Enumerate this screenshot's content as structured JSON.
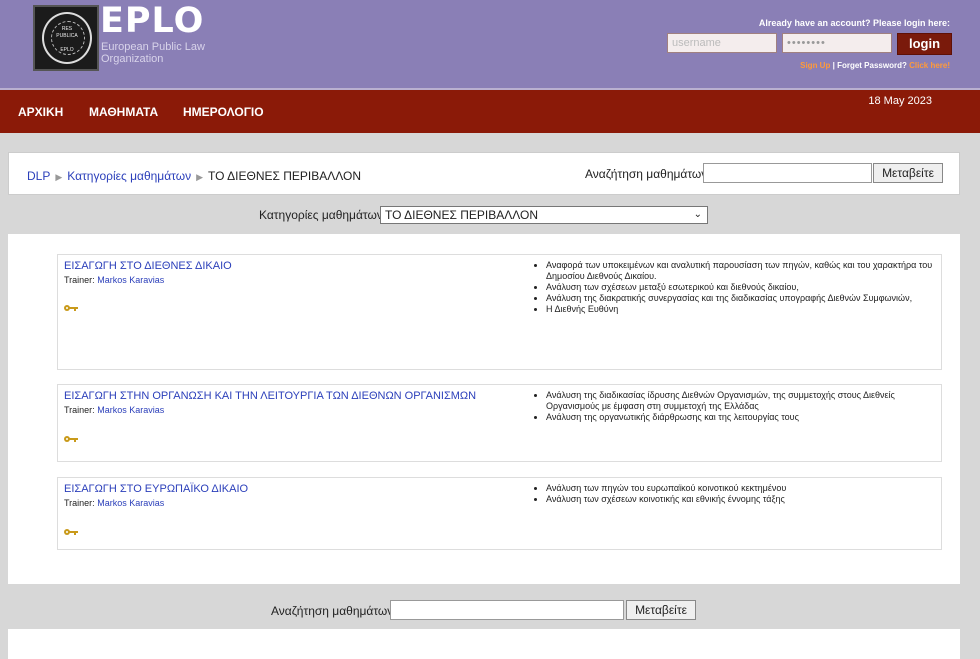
{
  "header": {
    "brand": "EPLO",
    "brand_sub1": "European Public Law",
    "brand_sub2": "Organization",
    "seal_top": "RES",
    "seal_mid": "PUBLICA",
    "seal_bot": "EPLO",
    "account_prompt": "Already have an account? Please login here:",
    "username_placeholder": "username",
    "password_placeholder": "••••••••",
    "login_label": "login",
    "signup": "Sign Up",
    "sep": "|",
    "forget": "Forget Password?",
    "click_here": "Click here!"
  },
  "nav": {
    "items": [
      "ΑΡΧΙΚΗ",
      "ΜΑΘΗΜΑΤΑ",
      "ΗΜΕΡΟΛΟΓΙΟ"
    ],
    "date": "18 May 2023"
  },
  "breadcrumb": {
    "items": [
      "DLP",
      "Κατηγορίες μαθημάτων",
      "ΤΟ ΔΙΕΘΝΕΣ ΠΕΡΙΒΑΛΛΟΝ"
    ],
    "search_label": "Αναζήτηση μαθημάτων:",
    "search_button": "Μεταβείτε"
  },
  "category": {
    "label": "Κατηγορίες μαθημάτων:",
    "selected": "ΤΟ ΔΙΕΘΝΕΣ ΠΕΡΙΒΑΛΛΟΝ"
  },
  "courses": [
    {
      "title": "ΕΙΣΑΓΩΓΗ ΣΤΟ ΔΙΕΘΝΕΣ ΔΙΚΑΙΟ",
      "trainer_label": "Trainer:",
      "trainer": "Markos Karavias",
      "summary": [
        "Αναφορά των υποκειμένων και αναλυτική παρουσίαση των πηγών, καθώς και του χαρακτήρα του Δημοσίου Διεθνούς Δικαίου.",
        "Ανάλυση των σχέσεων μεταξύ εσωτερικού και διεθνούς δικαίου,",
        "Ανάλυση της διακρατικής συνεργασίας και της διαδικασίας υπογραφής Διεθνών Συμφωνιών,",
        "Η Διεθνής Ευθύνη"
      ]
    },
    {
      "title": "ΕΙΣΑΓΩΓΗ ΣΤΗΝ ΟΡΓΑΝΩΣΗ ΚΑΙ ΤΗΝ ΛΕΙΤΟΥΡΓΙΑ ΤΩΝ ΔΙΕΘΝΩΝ ΟΡΓΑΝΙΣΜΩΝ",
      "trainer_label": "Trainer:",
      "trainer": "Markos Karavias",
      "summary": [
        "Ανάλυση της διαδικασίας ίδρυσης Διεθνών Οργανισμών, της συμμετοχής στους Διεθνείς Οργανισμούς με έμφαση στη συμμετοχή της Ελλάδας",
        "Ανάλυση της οργανωτικής διάρθρωσης και της λειτουργίας τους"
      ]
    },
    {
      "title": "ΕΙΣΑΓΩΓΗ ΣΤΟ ΕΥΡΩΠΑΪΚΟ ΔΙΚΑΙΟ",
      "trainer_label": "Trainer:",
      "trainer": "Markos Karavias",
      "summary": [
        "Ανάλυση των πηγών του ευρωπαϊκού κοινοτικού κεκτημένου",
        "Ανάλυση των σχέσεων κοινοτικής και εθνικής έννομης τάξης"
      ]
    }
  ],
  "bottom_search": {
    "label": "Αναζήτηση μαθημάτων:",
    "button": "Μεταβείτε"
  },
  "colors": {
    "header": "#8a7fb6",
    "nav": "#8b1a08",
    "link": "#2b3fba",
    "accent": "#ff9a3a"
  }
}
